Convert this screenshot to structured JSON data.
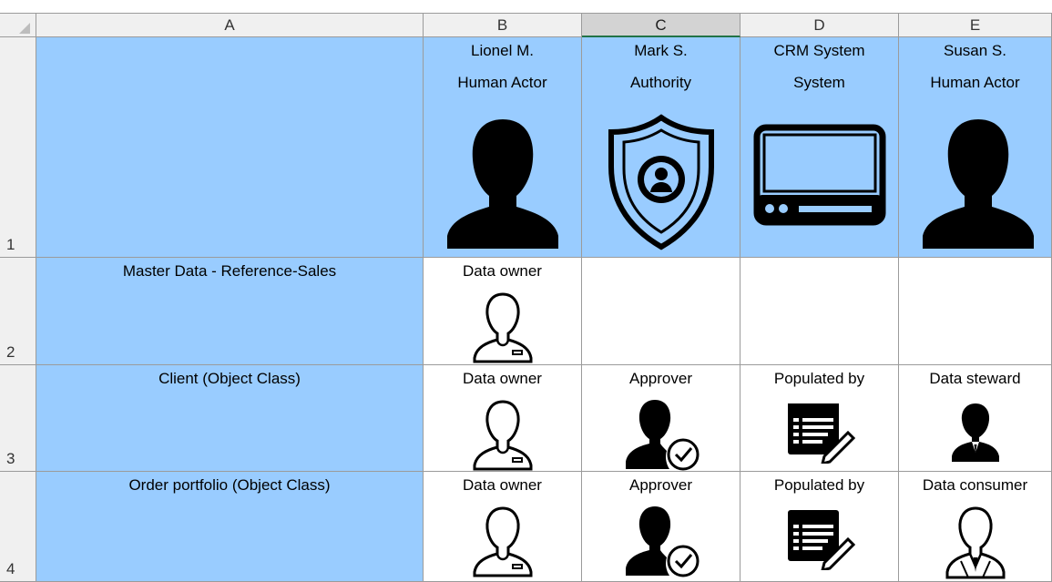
{
  "columns": [
    "A",
    "B",
    "C",
    "D",
    "E"
  ],
  "selected_column": "C",
  "rows": [
    "1",
    "2",
    "3",
    "4"
  ],
  "actors": [
    {
      "name": "Lionel M.",
      "role": "Human Actor",
      "icon": "person-silhouette-icon"
    },
    {
      "name": "Mark S.",
      "role": "Authority",
      "icon": "shield-user-icon"
    },
    {
      "name": "CRM System",
      "role": "System",
      "icon": "monitor-icon"
    },
    {
      "name": "Susan S.",
      "role": "Human Actor",
      "icon": "person-silhouette-icon"
    }
  ],
  "data_rows": [
    {
      "label": "Master Data - Reference-Sales",
      "cells": [
        {
          "text": "Data owner",
          "icon": "owner-outline-icon"
        },
        {
          "text": "",
          "icon": ""
        },
        {
          "text": "",
          "icon": ""
        },
        {
          "text": "",
          "icon": ""
        }
      ]
    },
    {
      "label": "Client (Object Class)",
      "cells": [
        {
          "text": "Data owner",
          "icon": "owner-outline-icon"
        },
        {
          "text": "Approver",
          "icon": "approver-check-icon"
        },
        {
          "text": "Populated by",
          "icon": "form-edit-icon"
        },
        {
          "text": "Data steward",
          "icon": "steward-icon"
        }
      ]
    },
    {
      "label": "Order portfolio (Object Class)",
      "cells": [
        {
          "text": "Data owner",
          "icon": "owner-outline-icon"
        },
        {
          "text": "Approver",
          "icon": "approver-check-icon"
        },
        {
          "text": "Populated by",
          "icon": "form-edit-icon"
        },
        {
          "text": "Data consumer",
          "icon": "consumer-outline-icon"
        }
      ]
    }
  ],
  "colors": {
    "header_fill": "#99ccff",
    "selected_header": "#d3d3d3",
    "accent": "#217346"
  }
}
